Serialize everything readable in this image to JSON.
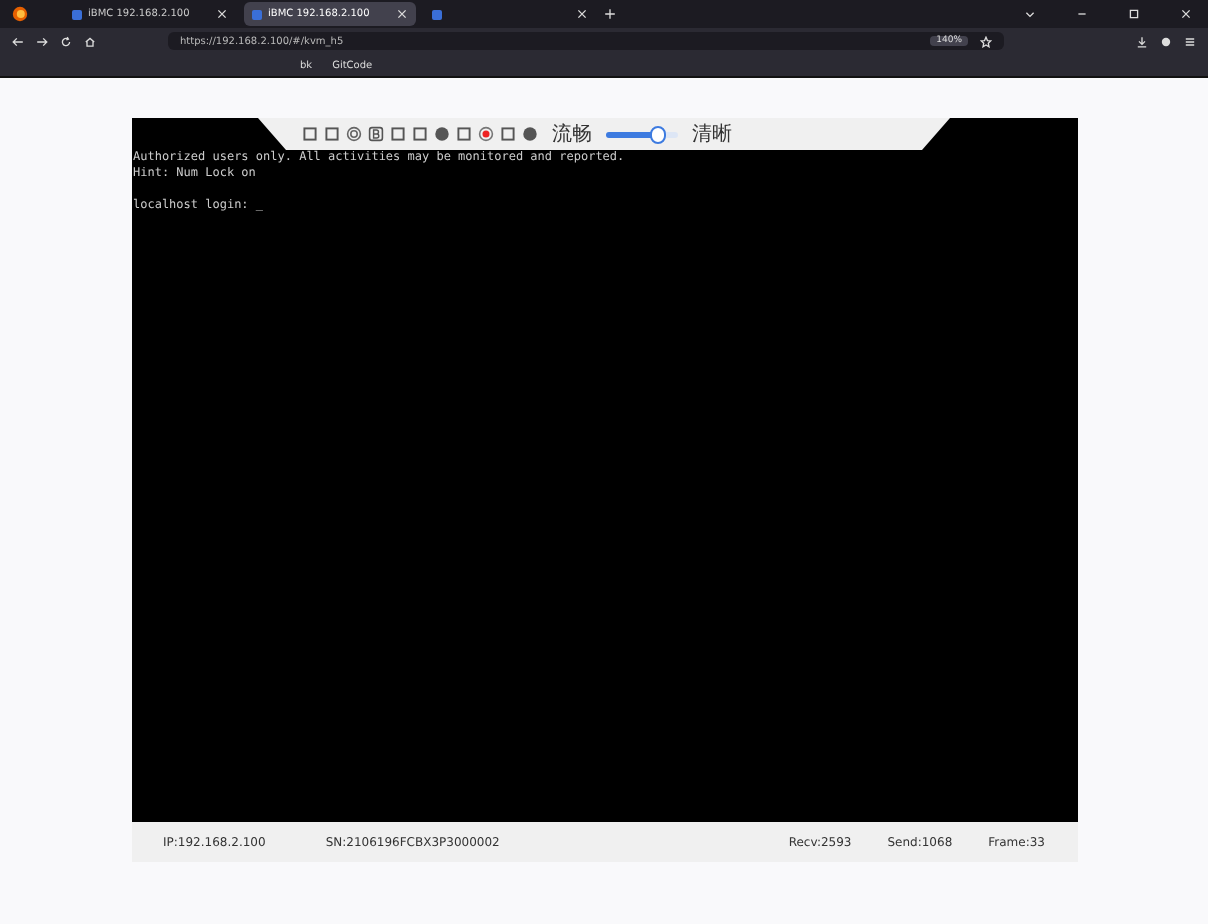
{
  "browser": {
    "tabs": [
      {
        "title": "iBMC 192.168.2.100",
        "selected": false
      },
      {
        "title": "iBMC 192.168.2.100",
        "selected": true
      },
      {
        "selected": false
      }
    ],
    "address": "https://192.168.2.100/#/kvm_h5",
    "zoom": "140%",
    "bookmarks": [
      "bk",
      "GitCode"
    ]
  },
  "console": {
    "blocks": [
      [
        "Authorized users only. All activities may be monitored and reported.",
        "Hint: Num Lock on"
      ],
      [
        "localhost login: _"
      ]
    ],
    "toolbar": {
      "quality": {
        "low_label": "流畅",
        "high_label": "清晰",
        "level": 0.75
      }
    },
    "status": {
      "ip": "IP:192.168.2.100",
      "sn": "SN:2106196FCBX3P3000002",
      "recv": "Recv:2593",
      "send": "Send:1068",
      "frame": "Frame:33"
    }
  }
}
